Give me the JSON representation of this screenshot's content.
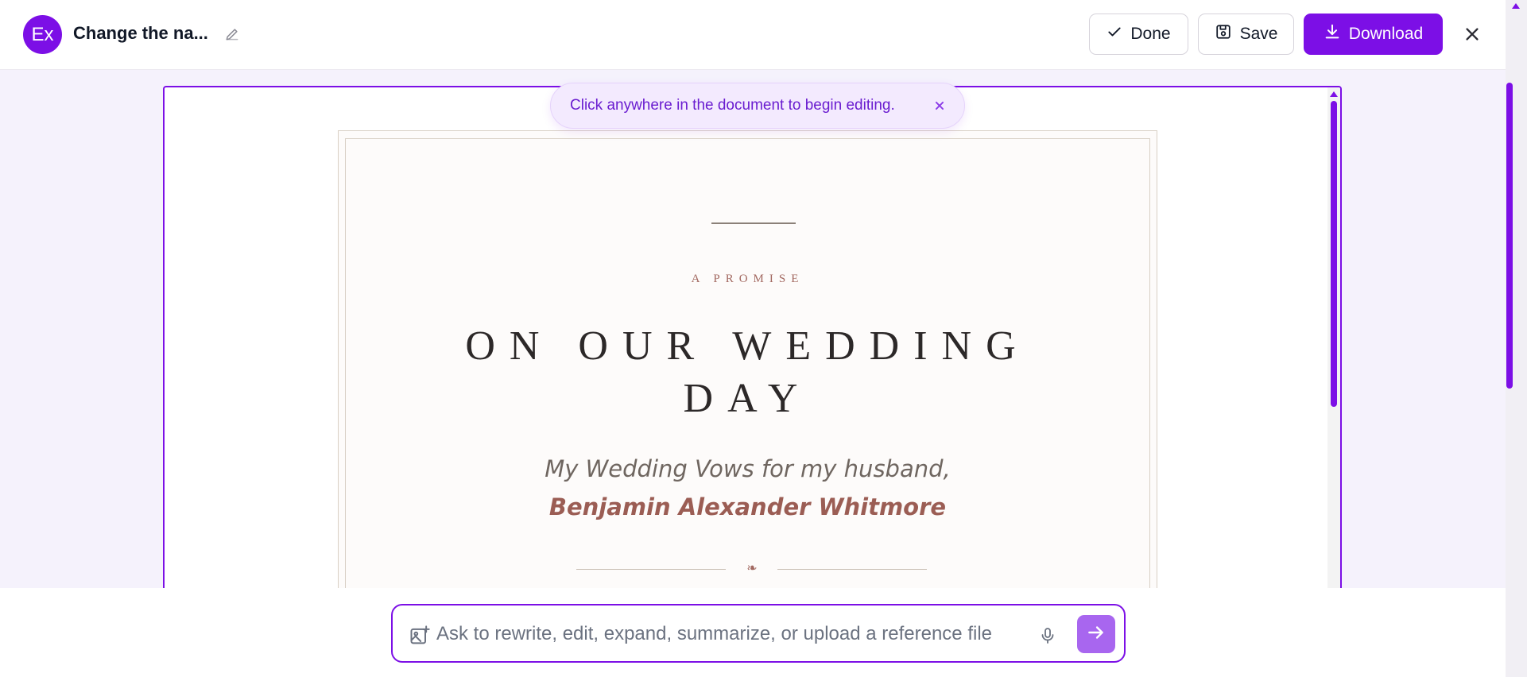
{
  "header": {
    "avatar_text": "Ex",
    "doc_title": "Change the na...",
    "done_label": "Done",
    "save_label": "Save",
    "download_label": "Download",
    "accent_color": "#7c0fe6"
  },
  "toast": {
    "message": "Click anywhere in the document to begin editing."
  },
  "document": {
    "kicker": "A PROMISE",
    "headline_line1": "ON OUR WEDDING",
    "headline_line2": "DAY",
    "subtitle": "My Wedding Vows for my husband,",
    "name": "Benjamin Alexander Whitmore",
    "fleuron": "❧",
    "name_color": "#9b5d54"
  },
  "prompt": {
    "placeholder": "Ask to rewrite, edit, expand, summarize, or upload a reference file"
  },
  "icons": [
    "pencil-icon",
    "check-icon",
    "save-icon",
    "download-icon",
    "close-icon",
    "image-plus-icon",
    "mic-icon",
    "arrow-right-icon"
  ]
}
